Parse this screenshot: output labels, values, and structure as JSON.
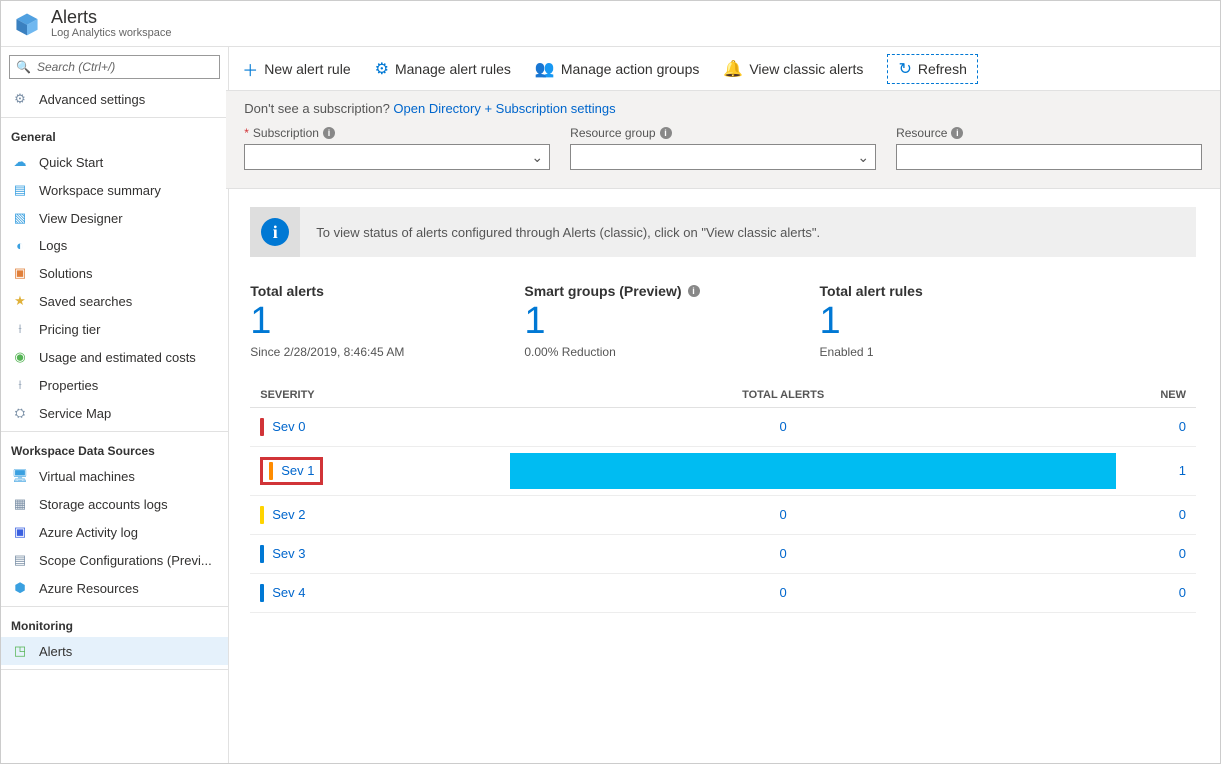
{
  "header": {
    "title": "Alerts",
    "subtitle": "Log Analytics workspace"
  },
  "search": {
    "placeholder": "Search (Ctrl+/)"
  },
  "collapse_hint": "«",
  "sidebar": {
    "top": {
      "advanced": "Advanced settings"
    },
    "sections": [
      {
        "title": "General",
        "items": [
          {
            "icon": "☁",
            "label": "Quick Start",
            "color": "#3aa0e0"
          },
          {
            "icon": "▤",
            "label": "Workspace summary",
            "color": "#3aa0e0"
          },
          {
            "icon": "▧",
            "label": "View Designer",
            "color": "#3aa0e0"
          },
          {
            "icon": "◐",
            "label": "Logs",
            "color": "#3aa0e0"
          },
          {
            "icon": "▣",
            "label": "Solutions",
            "color": "#e07f3a"
          },
          {
            "icon": "★",
            "label": "Saved searches",
            "color": "#e0b13a"
          },
          {
            "icon": "⟊",
            "label": "Pricing tier",
            "color": "#7a8fa6"
          },
          {
            "icon": "◉",
            "label": "Usage and estimated costs",
            "color": "#55b455"
          },
          {
            "icon": "⟊",
            "label": "Properties",
            "color": "#7a8fa6"
          },
          {
            "icon": "⛭",
            "label": "Service Map",
            "color": "#7a8fa6"
          }
        ]
      },
      {
        "title": "Workspace Data Sources",
        "items": [
          {
            "icon": "🖥",
            "label": "Virtual machines",
            "color": "#3aa0e0"
          },
          {
            "icon": "▦",
            "label": "Storage accounts logs",
            "color": "#7a8fa6"
          },
          {
            "icon": "▣",
            "label": "Azure Activity log",
            "color": "#3a60e0"
          },
          {
            "icon": "▤",
            "label": "Scope Configurations (Previ...",
            "color": "#7a8fa6"
          },
          {
            "icon": "⬢",
            "label": "Azure Resources",
            "color": "#3aa0e0"
          }
        ]
      },
      {
        "title": "Monitoring",
        "items": [
          {
            "icon": "◳",
            "label": "Alerts",
            "color": "#55b455",
            "active": true
          }
        ]
      }
    ]
  },
  "toolbar": {
    "new_rule": "New alert rule",
    "manage_rules": "Manage alert rules",
    "manage_groups": "Manage action groups",
    "view_classic": "View classic alerts",
    "refresh": "Refresh"
  },
  "filter": {
    "hint_prefix": "Don't see a subscription? ",
    "hint_link": "Open Directory + Subscription settings",
    "subscription": "Subscription",
    "resource_group": "Resource group",
    "resource": "Resource"
  },
  "classic_banner": "To view status of alerts configured through Alerts (classic), click on \"View classic alerts\".",
  "stats": {
    "total": {
      "title": "Total alerts",
      "value": "1",
      "sub": "Since 2/28/2019, 8:46:45 AM"
    },
    "smart": {
      "title": "Smart groups (Preview)",
      "value": "1",
      "sub": "0.00% Reduction"
    },
    "rules": {
      "title": "Total alert rules",
      "value": "1",
      "sub": "Enabled 1"
    }
  },
  "table": {
    "headers": {
      "severity": "SEVERITY",
      "total": "TOTAL ALERTS",
      "new": "NEW"
    },
    "rows": [
      {
        "name": "Sev 0",
        "total": "0",
        "new": "0",
        "cls": "sev0",
        "fill": false,
        "highlight": false
      },
      {
        "name": "Sev 1",
        "total": "1",
        "new": "1",
        "cls": "sev1",
        "fill": true,
        "highlight": true
      },
      {
        "name": "Sev 2",
        "total": "0",
        "new": "0",
        "cls": "sev2",
        "fill": false,
        "highlight": false
      },
      {
        "name": "Sev 3",
        "total": "0",
        "new": "0",
        "cls": "sev3",
        "fill": false,
        "highlight": false
      },
      {
        "name": "Sev 4",
        "total": "0",
        "new": "0",
        "cls": "sev4",
        "fill": false,
        "highlight": false
      }
    ]
  }
}
